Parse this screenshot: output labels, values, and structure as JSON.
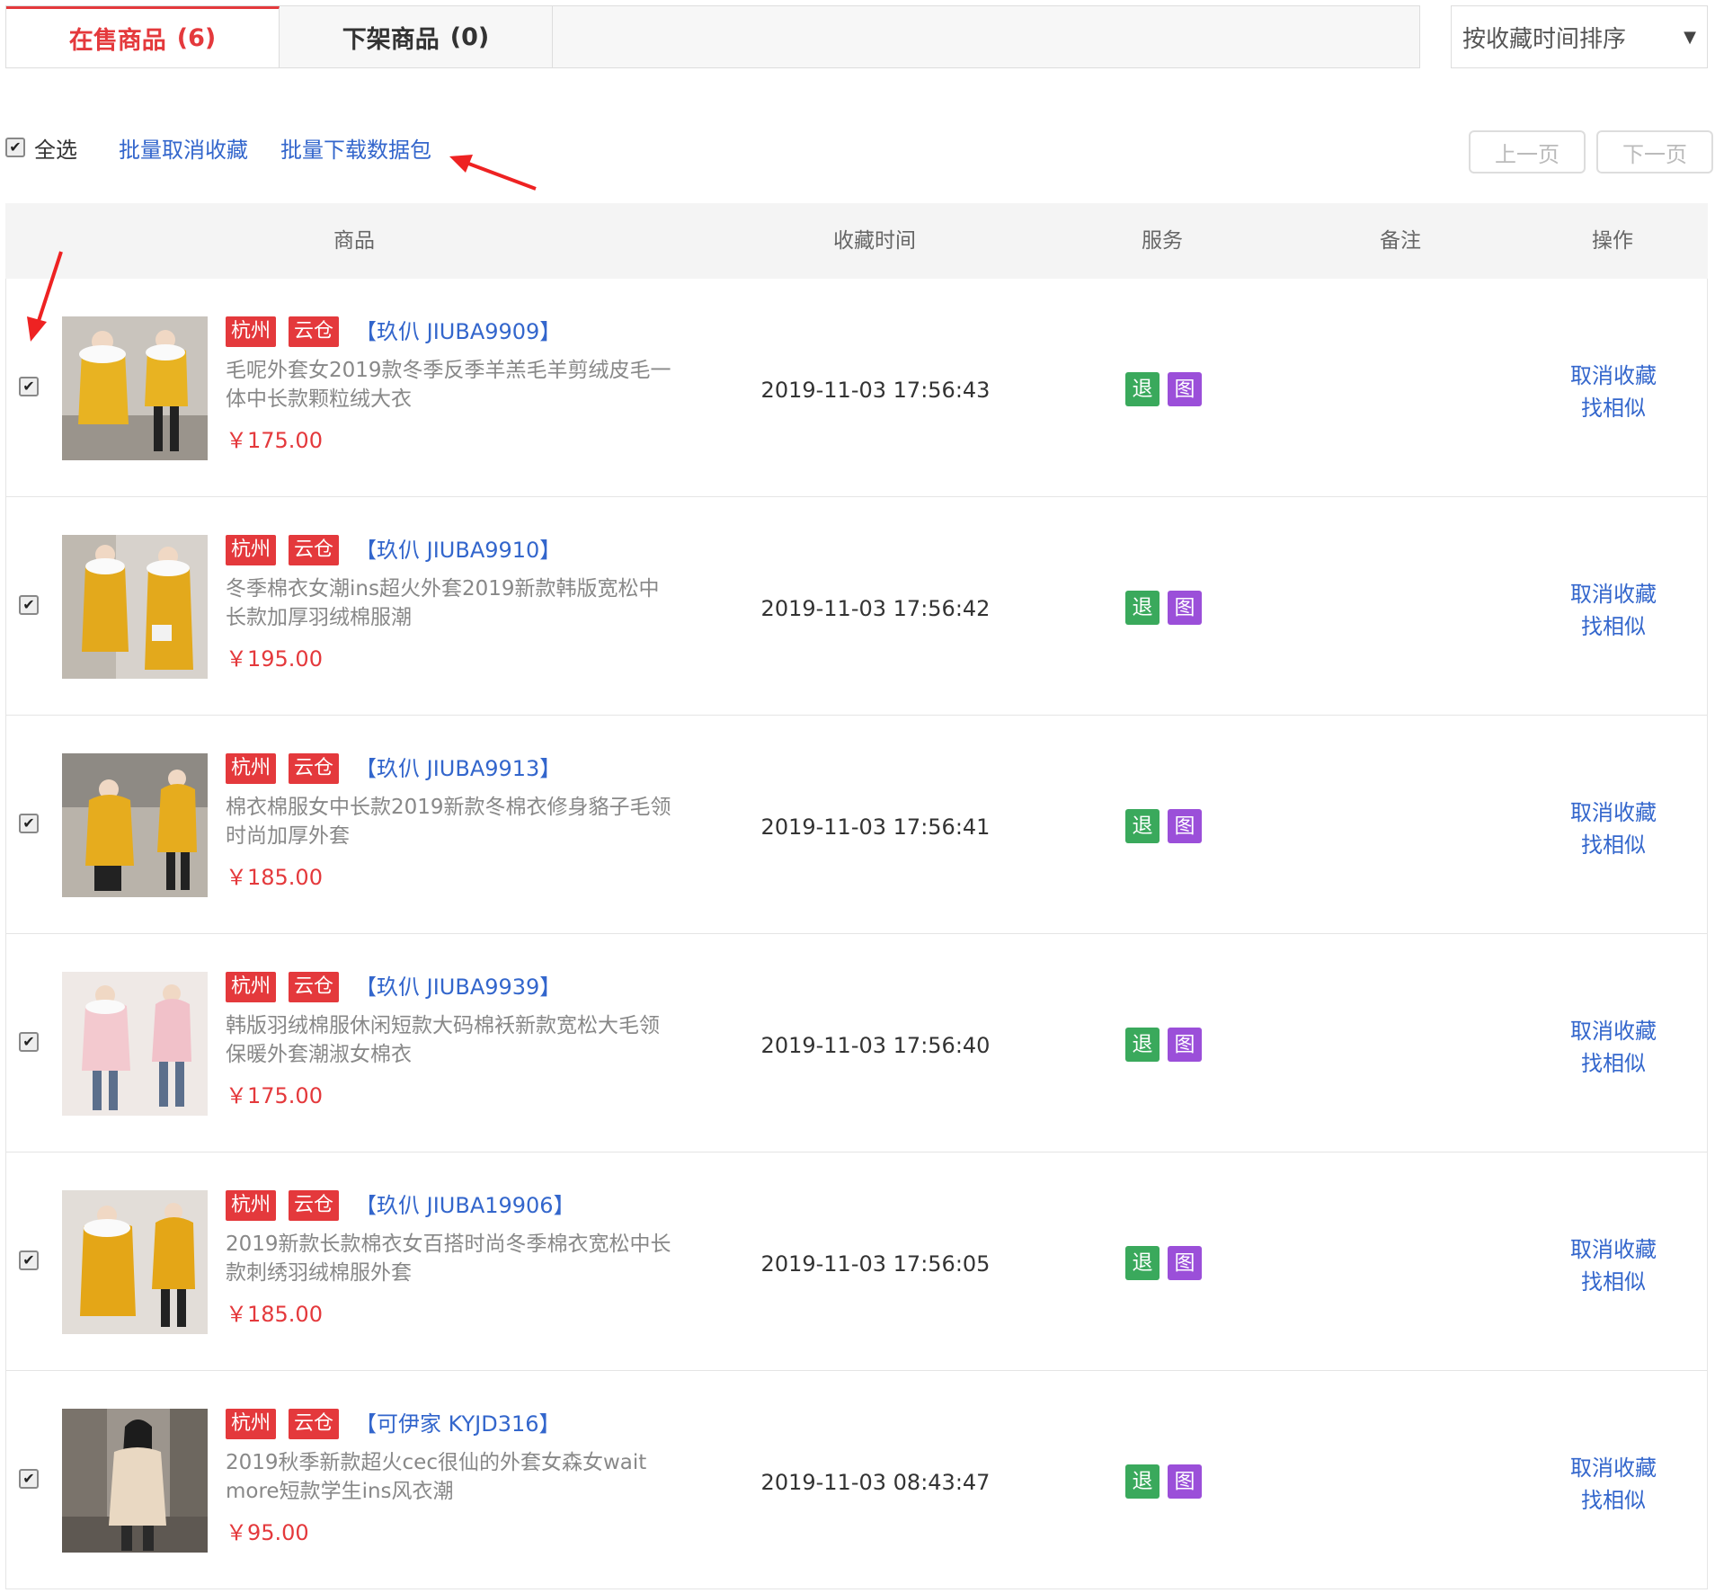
{
  "tabs": [
    {
      "label": "在售商品",
      "count": "(6)",
      "active": true
    },
    {
      "label": "下架商品",
      "count": "(0)",
      "active": false
    }
  ],
  "sort": {
    "selected": "按收藏时间排序",
    "caret": "▼"
  },
  "toolbar": {
    "select_all": "全选",
    "batch_cancel": "批量取消收藏",
    "batch_download": "批量下载数据包"
  },
  "pager": {
    "prev": "上一页",
    "next": "下一页"
  },
  "columns": {
    "product": "商品",
    "time": "收藏时间",
    "service": "服务",
    "note": "备注",
    "action": "操作"
  },
  "check_glyph": "✔",
  "rows": [
    {
      "city": "杭州",
      "cloud": "云仓",
      "brand": "【玖仈 JIUBA9909】",
      "desc": "毛呢外套女2019款冬季反季羊羔毛羊剪绒皮毛一体中长款颗粒绒大衣",
      "price": "￥175.00",
      "time": "2019-11-03 17:56:43",
      "svc_return": "退",
      "svc_image": "图",
      "cancel": "取消收藏",
      "similar": "找相似"
    },
    {
      "city": "杭州",
      "cloud": "云仓",
      "brand": "【玖仈 JIUBA9910】",
      "desc": "冬季棉衣女潮ins超火外套2019新款韩版宽松中长款加厚羽绒棉服潮",
      "price": "￥195.00",
      "time": "2019-11-03 17:56:42",
      "svc_return": "退",
      "svc_image": "图",
      "cancel": "取消收藏",
      "similar": "找相似"
    },
    {
      "city": "杭州",
      "cloud": "云仓",
      "brand": "【玖仈 JIUBA9913】",
      "desc": "棉衣棉服女中长款2019新款冬棉衣修身貉子毛领时尚加厚外套",
      "price": "￥185.00",
      "time": "2019-11-03 17:56:41",
      "svc_return": "退",
      "svc_image": "图",
      "cancel": "取消收藏",
      "similar": "找相似"
    },
    {
      "city": "杭州",
      "cloud": "云仓",
      "brand": "【玖仈 JIUBA9939】",
      "desc": "韩版羽绒棉服休闲短款大码棉袄新款宽松大毛领保暖外套潮淑女棉衣",
      "price": "￥175.00",
      "time": "2019-11-03 17:56:40",
      "svc_return": "退",
      "svc_image": "图",
      "cancel": "取消收藏",
      "similar": "找相似"
    },
    {
      "city": "杭州",
      "cloud": "云仓",
      "brand": "【玖仈 JIUBA19906】",
      "desc": "2019新款长款棉衣女百搭时尚冬季棉衣宽松中长款刺绣羽绒棉服外套",
      "price": "￥185.00",
      "time": "2019-11-03 17:56:05",
      "svc_return": "退",
      "svc_image": "图",
      "cancel": "取消收藏",
      "similar": "找相似"
    },
    {
      "city": "杭州",
      "cloud": "云仓",
      "brand": "【可伊家 KYJD316】",
      "desc": "2019秋季新款超火cec很仙的外套女森女wait more短款学生ins风衣潮",
      "price": "￥95.00",
      "time": "2019-11-03 08:43:47",
      "svc_return": "退",
      "svc_image": "图",
      "cancel": "取消收藏",
      "similar": "找相似"
    }
  ],
  "colors": {
    "accent": "#e4393c",
    "link": "#3366cc",
    "return_badge": "#3aa95c",
    "image_badge": "#9b4fd9"
  }
}
